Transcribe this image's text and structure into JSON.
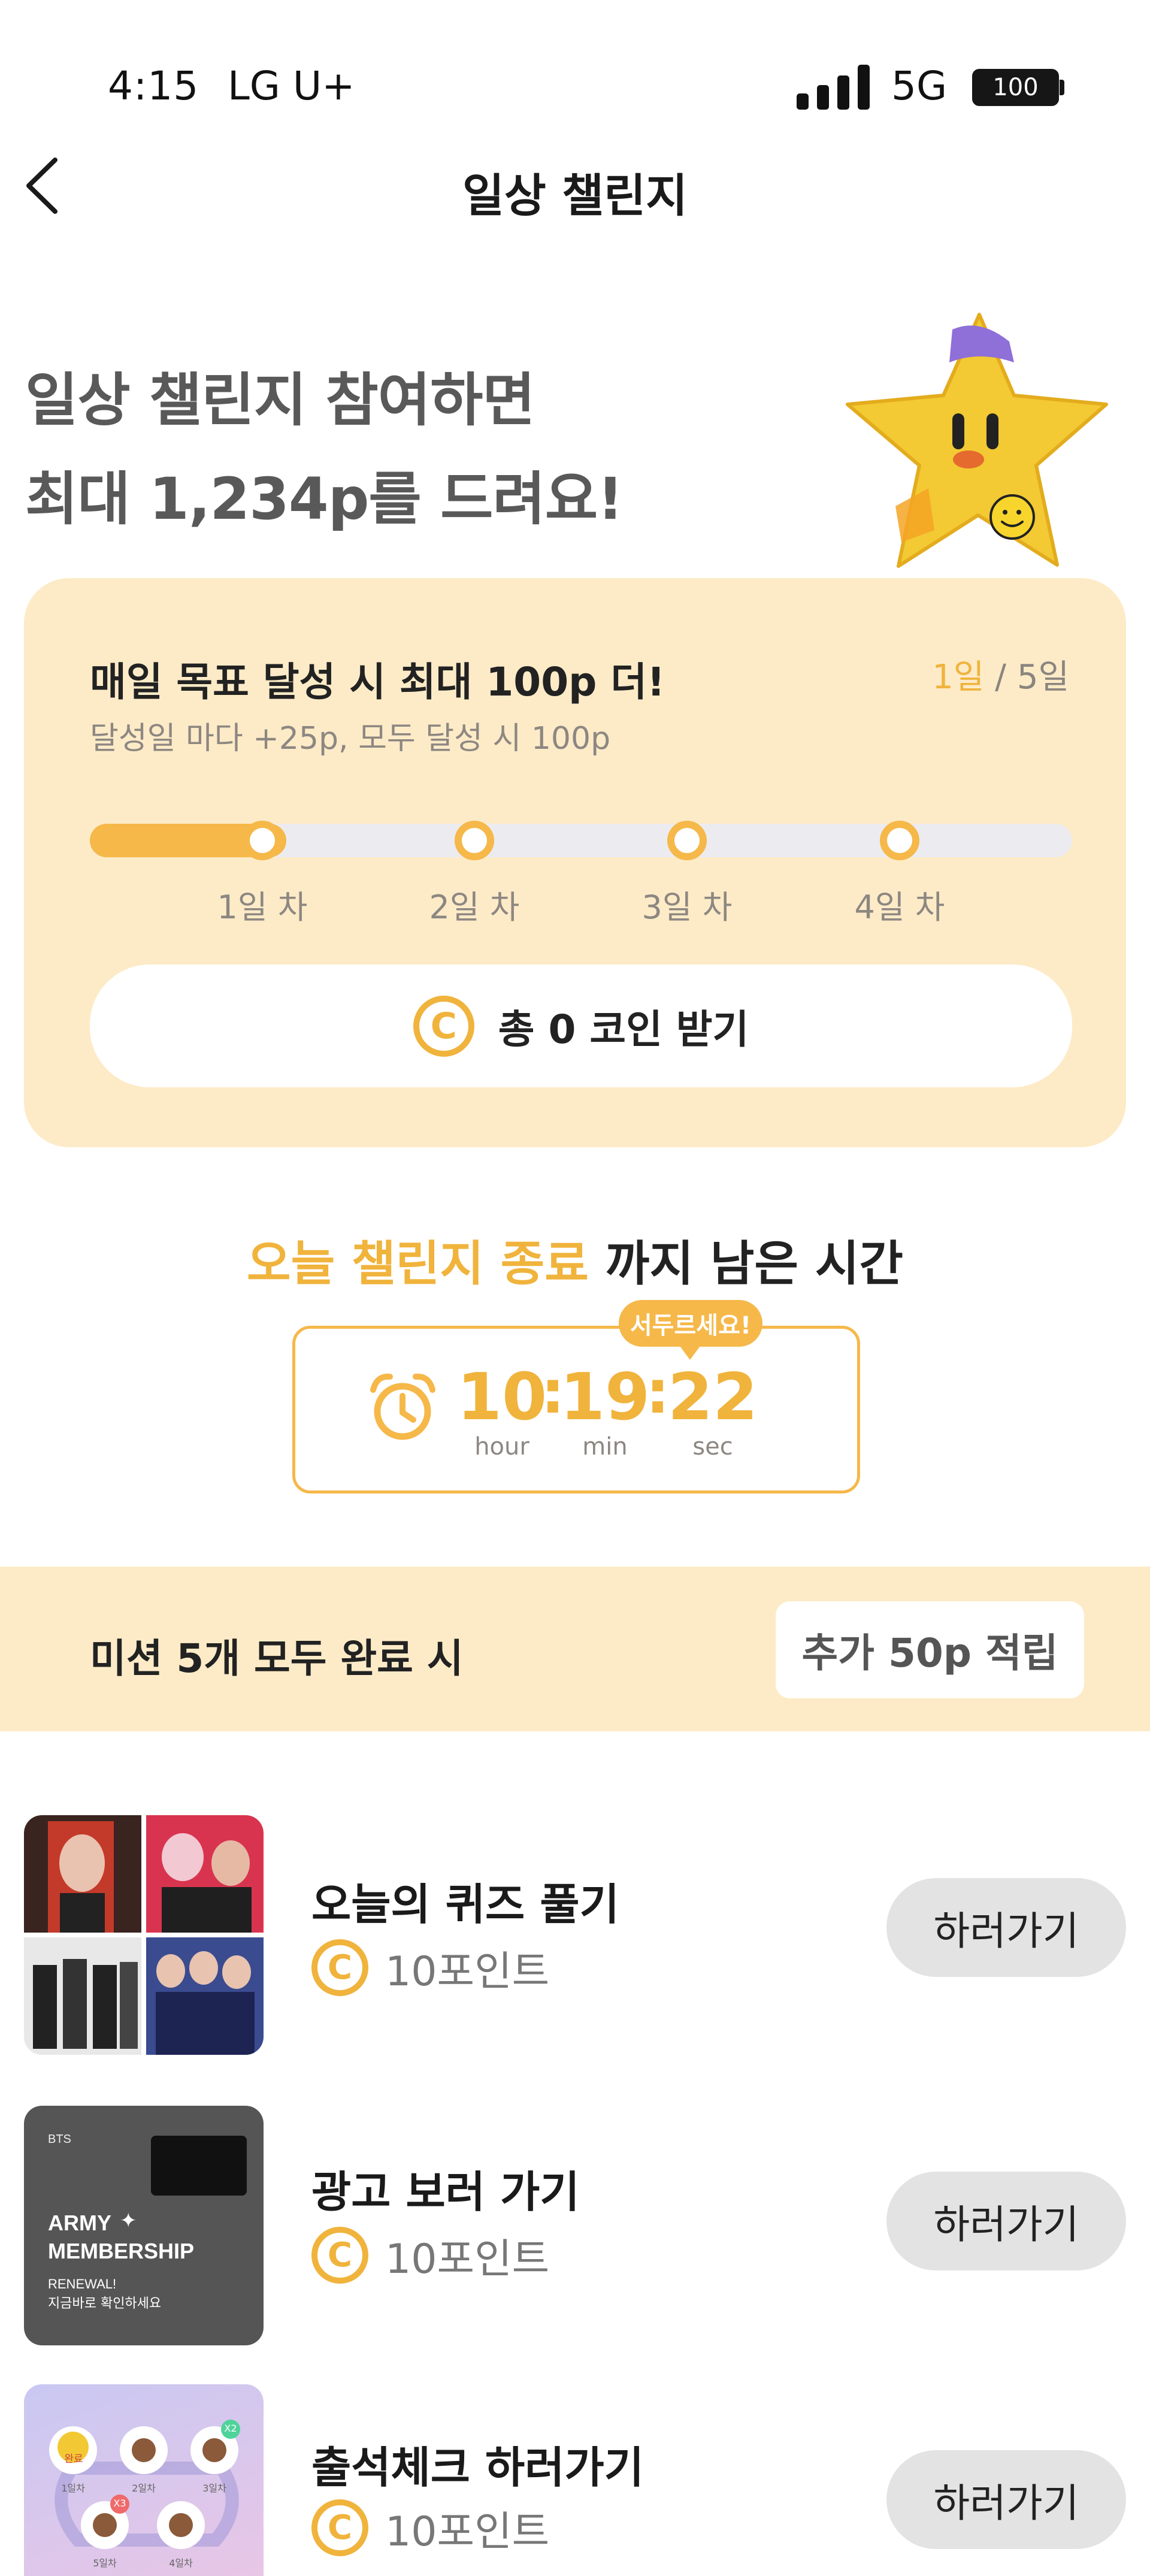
{
  "status_bar": {
    "time": "4:15",
    "carrier": "LG U+",
    "network": "5G",
    "battery": "100"
  },
  "nav": {
    "title": "일상 챌린지",
    "back_icon": "chevron-left-icon"
  },
  "hero": {
    "line1": "일상 챌린지 참여하면",
    "line2": "최대 1,234p를 드려요!",
    "mascot_icon": "star-mascot-icon"
  },
  "daily_goal": {
    "title": "매일 목표 달성 시 최대 100p 더!",
    "subtitle": "달성일 마다 +25p, 모두 달성 시 100p",
    "current_day": "1일",
    "total_days": "/ 5일",
    "progress_fraction": 0.2,
    "days": [
      {
        "label": "1일 차",
        "done": true
      },
      {
        "label": "2일 차",
        "done": false
      },
      {
        "label": "3일 차",
        "done": false
      },
      {
        "label": "4일 차",
        "done": false
      }
    ],
    "claim_coin": "C",
    "claim_label": "총 0 코인 받기"
  },
  "countdown": {
    "title_highlight": "오늘 챌린지 종료",
    "title_rest": " 까지 남은 시간",
    "badge": "서두르세요!",
    "hours": "10",
    "minutes": "19",
    "seconds": "22",
    "hour_label": "hour",
    "min_label": "min",
    "sec_label": "sec",
    "separator": ":"
  },
  "mission_bonus": {
    "label": "미션 5개 모두 완료 시",
    "reward": "추가 50p 적립"
  },
  "missions": [
    {
      "title": "오늘의 퀴즈 풀기",
      "coin": "C",
      "points": "10포인트",
      "button": "하러가기"
    },
    {
      "title": "광고 보러 가기",
      "coin": "C",
      "points": "10포인트",
      "button": "하러가기",
      "thumb": {
        "brand": "BTS",
        "title1": "ARMY",
        "title2": "MEMBERSHIP",
        "sub1": "RENEWAL!",
        "sub2": "지금바로 확인하세요"
      }
    },
    {
      "title": "출석체크 하러가기",
      "coin": "C",
      "points": "10포인트",
      "button": "하러가기",
      "thumb": {
        "badge_x2": "X2",
        "badge_x3": "X3",
        "d1": "1일차",
        "d2": "2일차",
        "d3": "3일차",
        "d4": "4일차",
        "d5": "5일차",
        "done": "완료"
      }
    }
  ],
  "colors": {
    "accent": "#f5b849",
    "accent_text": "#f0b33c",
    "card_bg": "#fdebc7",
    "button_gray": "#e3e3e3"
  }
}
